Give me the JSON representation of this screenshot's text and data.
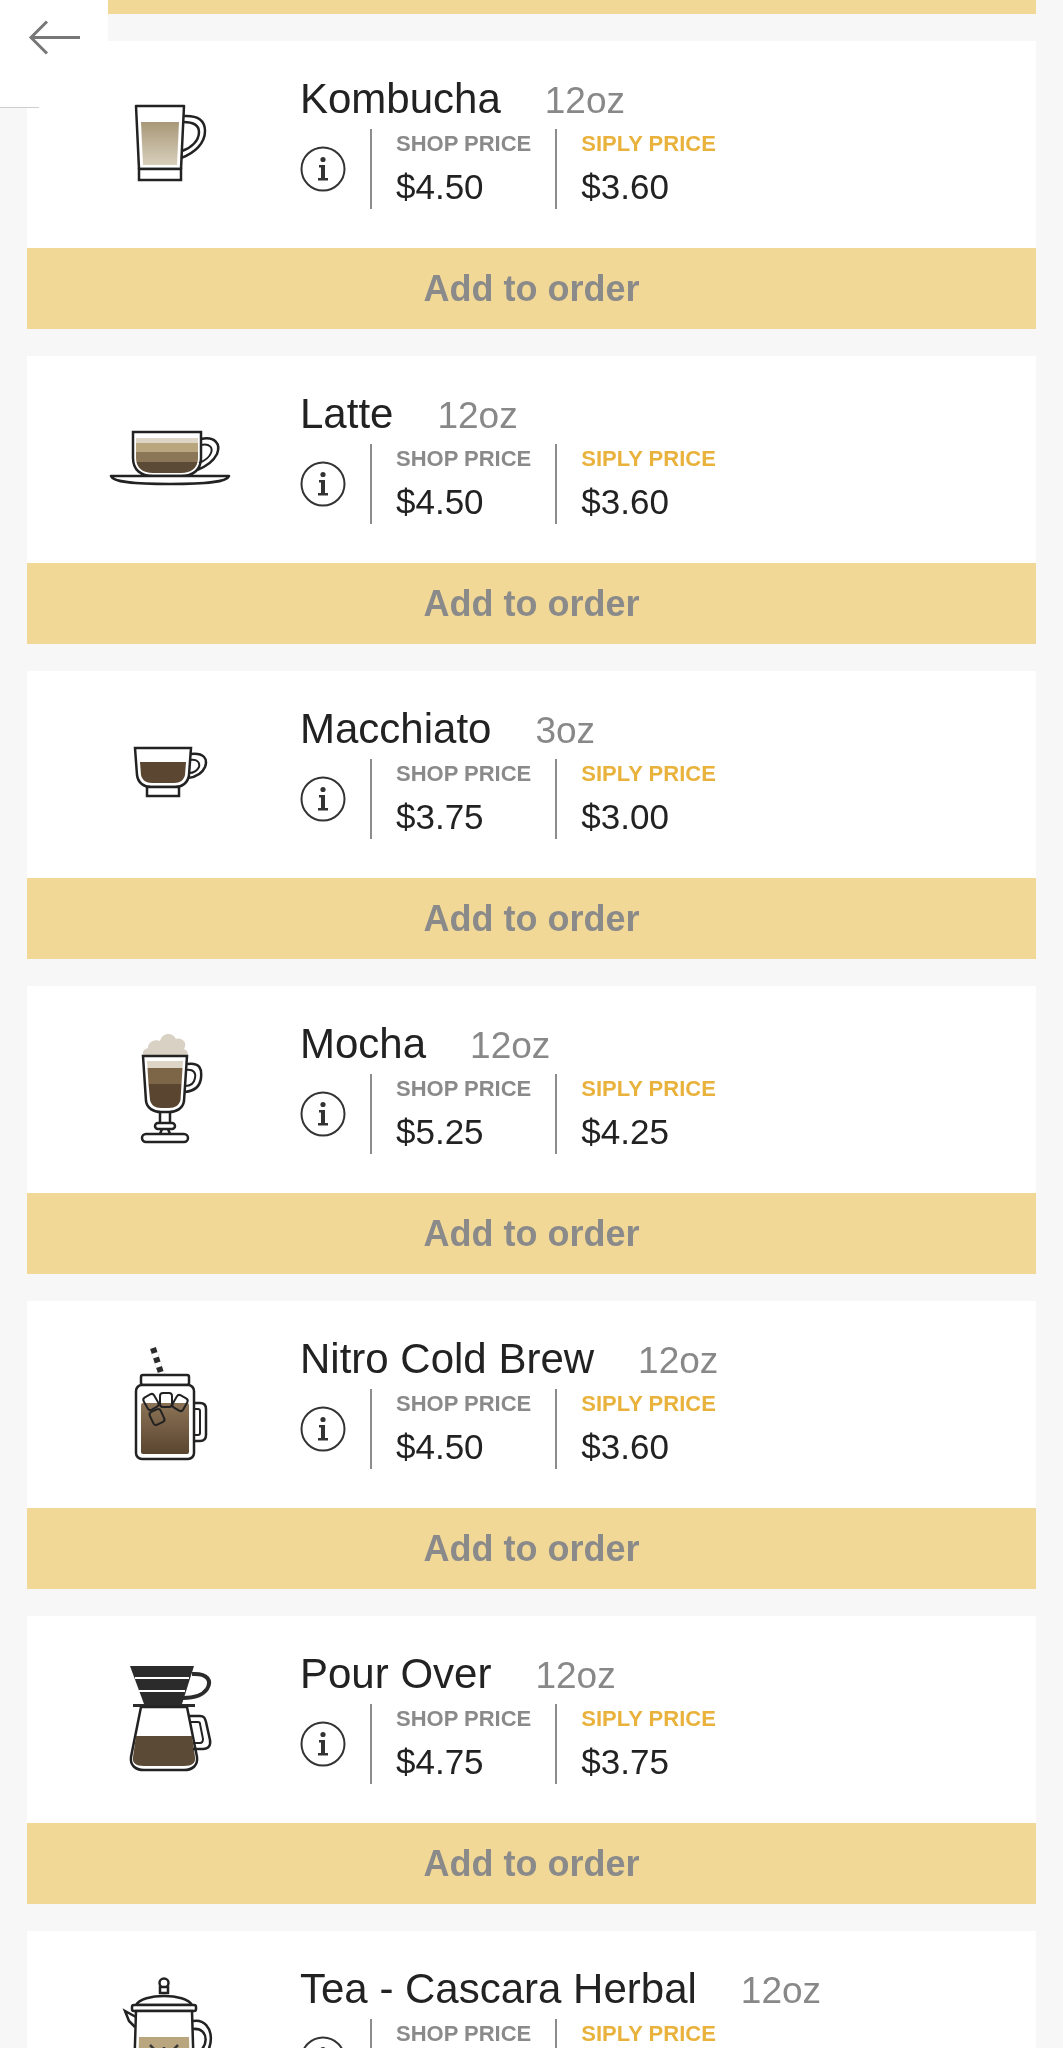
{
  "items": [
    {
      "kind": "mug",
      "name": "Kombucha",
      "size": "12oz",
      "prices": [
        {
          "kind": "shop",
          "label": "SHOP PRICE",
          "value": "$4.50"
        },
        {
          "kind": "siply",
          "label": "SIPLY PRICE",
          "value": "$3.60"
        }
      ],
      "button": "Add to order"
    },
    {
      "kind": "saucer",
      "name": "Latte",
      "size": "12oz",
      "prices": [
        {
          "kind": "shop",
          "label": "SHOP PRICE",
          "value": "$4.50"
        },
        {
          "kind": "siply",
          "label": "SIPLY PRICE",
          "value": "$3.60"
        }
      ],
      "button": "Add to order"
    },
    {
      "kind": "demitasse",
      "name": "Macchiato",
      "size": "3oz",
      "prices": [
        {
          "kind": "shop",
          "label": "SHOP PRICE",
          "value": "$3.75"
        },
        {
          "kind": "siply",
          "label": "SIPLY PRICE",
          "value": "$3.00"
        }
      ],
      "button": "Add to order"
    },
    {
      "kind": "goblet",
      "name": "Mocha",
      "size": "12oz",
      "prices": [
        {
          "kind": "shop",
          "label": "SHOP PRICE",
          "value": "$5.25"
        },
        {
          "kind": "siply",
          "label": "SIPLY PRICE",
          "value": "$4.25"
        }
      ],
      "button": "Add to order"
    },
    {
      "kind": "jar",
      "name": "Nitro Cold Brew",
      "size": "12oz",
      "prices": [
        {
          "kind": "shop",
          "label": "SHOP PRICE",
          "value": "$4.50"
        },
        {
          "kind": "siply",
          "label": "SIPLY PRICE",
          "value": "$3.60"
        }
      ],
      "button": "Add to order"
    },
    {
      "kind": "dripper",
      "name": "Pour Over",
      "size": "12oz",
      "prices": [
        {
          "kind": "shop",
          "label": "SHOP PRICE",
          "value": "$4.75"
        },
        {
          "kind": "siply",
          "label": "SIPLY PRICE",
          "value": "$3.75"
        }
      ],
      "button": "Add to order"
    },
    {
      "kind": "teapot",
      "name": "Tea - Cascara Herbal",
      "size": "12oz",
      "prices": [
        {
          "kind": "shop",
          "label": "SHOP PRICE"
        },
        {
          "kind": "siply",
          "label": "SIPLY PRICE"
        }
      ]
    }
  ]
}
